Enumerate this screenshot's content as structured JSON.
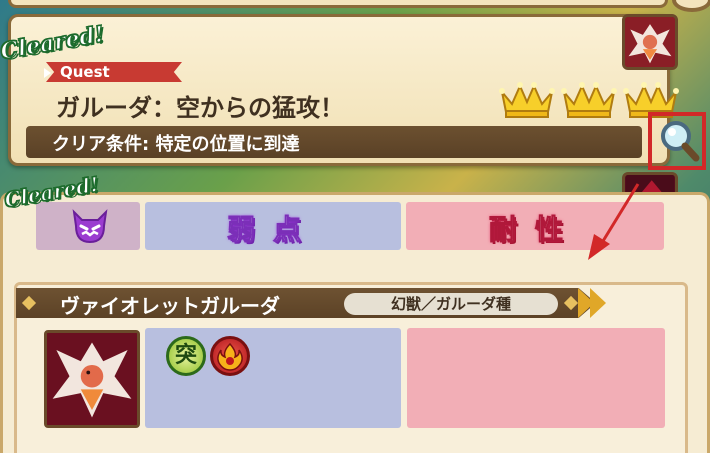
{
  "quest_card": {
    "cleared_label": "Cleared!",
    "tag": "Quest",
    "title": "ガルーダ：空からの猛攻！",
    "clear_condition": "クリア条件: 特定の位置に到達",
    "crowns": 3
  },
  "next_card": {
    "cleared_label": "Cleared!"
  },
  "detail": {
    "weakness_header": "弱点",
    "resistance_header": "耐性",
    "enemy_name": "ヴァイオレットガルーダ",
    "enemy_type": "幻獣／ガルーダ種",
    "weakness_icons": [
      "pierce-icon",
      "fire-icon"
    ],
    "pierce_glyph": "突"
  },
  "colors": {
    "highlight": "#d22828",
    "weakness_bg": "#b8bfdf",
    "resistance_bg": "#f2aeb6"
  }
}
